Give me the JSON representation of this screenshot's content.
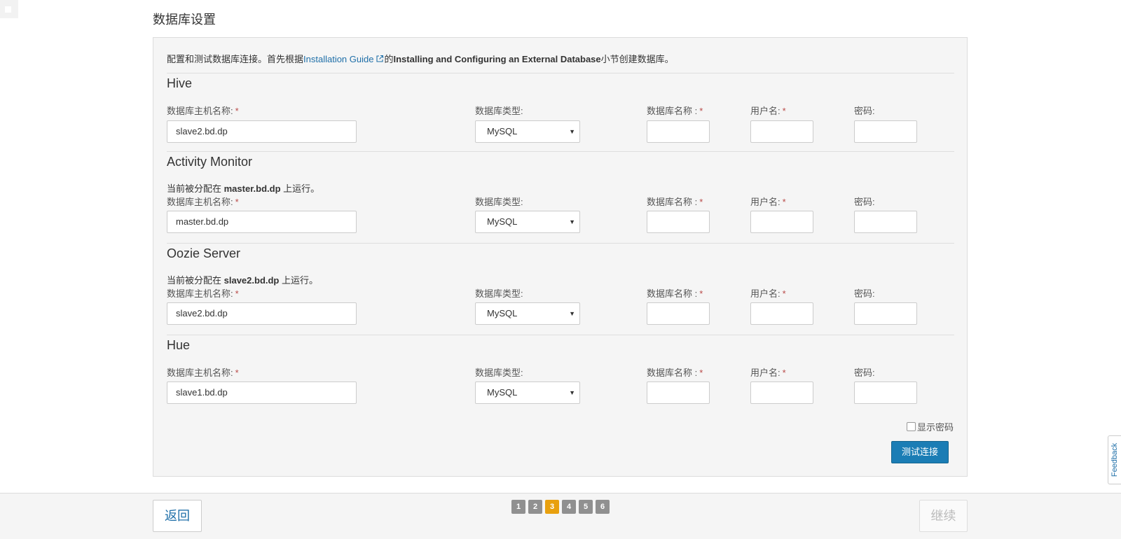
{
  "page": {
    "title": "数据库设置"
  },
  "intro": {
    "prefix": "配置和测试数据库连接。首先根据",
    "link": "Installation Guide",
    "mid": "的",
    "bold": "Installing and Configuring an External Database",
    "suffix": "小节创建数据库。"
  },
  "labels": {
    "host": "数据库主机名称:",
    "type": "数据库类型:",
    "dbname": "数据库名称 :",
    "user": "用户名:",
    "password": "密码:",
    "required": "*"
  },
  "sections": [
    {
      "title": "Hive",
      "note_prefix": "",
      "note_host": "",
      "note_suffix": "",
      "host": "slave2.bd.dp",
      "type": "MySQL",
      "dbname": "",
      "user": "",
      "password": ""
    },
    {
      "title": "Activity Monitor",
      "note_prefix": "当前被分配在 ",
      "note_host": "master.bd.dp",
      "note_suffix": " 上运行。",
      "host": "master.bd.dp",
      "type": "MySQL",
      "dbname": "",
      "user": "",
      "password": ""
    },
    {
      "title": "Oozie Server",
      "note_prefix": "当前被分配在 ",
      "note_host": "slave2.bd.dp",
      "note_suffix": " 上运行。",
      "host": "slave2.bd.dp",
      "type": "MySQL",
      "dbname": "",
      "user": "",
      "password": ""
    },
    {
      "title": "Hue",
      "note_prefix": "",
      "note_host": "",
      "note_suffix": "",
      "host": "slave1.bd.dp",
      "type": "MySQL",
      "dbname": "",
      "user": "",
      "password": ""
    }
  ],
  "show_password": {
    "label": "显示密码",
    "checked": false
  },
  "buttons": {
    "test": "测试连接",
    "back": "返回",
    "next": "继续"
  },
  "steps": {
    "items": [
      "1",
      "2",
      "3",
      "4",
      "5",
      "6"
    ],
    "current": "3"
  },
  "feedback": "Feedback",
  "colors": {
    "primary": "#1b7db5",
    "step_active": "#e8a00e",
    "step": "#909090",
    "link": "#1f6fa8",
    "required": "#b94a48"
  }
}
